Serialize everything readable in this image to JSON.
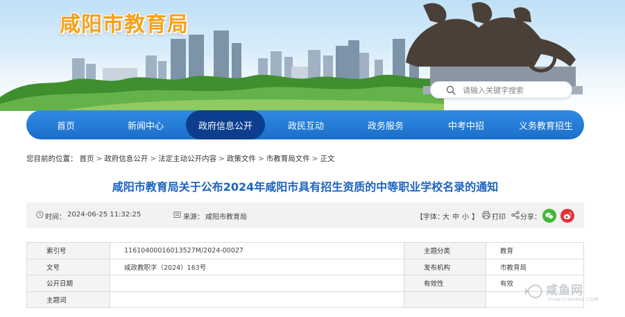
{
  "header": {
    "site_title": "咸阳市教育局",
    "search": {
      "placeholder": "请输入关键字搜索"
    }
  },
  "nav": {
    "items": [
      {
        "label": "首页",
        "active": false
      },
      {
        "label": "新闻中心",
        "active": false
      },
      {
        "label": "政府信息公开",
        "active": true
      },
      {
        "label": "政民互动",
        "active": false
      },
      {
        "label": "政务服务",
        "active": false
      },
      {
        "label": "中考中招",
        "active": false
      },
      {
        "label": "义务教育招生",
        "active": false
      }
    ]
  },
  "breadcrumb": {
    "prefix": "您目前的位置：",
    "items": [
      "首页",
      "政府信息公开",
      "法定主动公开内容",
      "政策文件",
      "市教育局文件",
      "正文"
    ],
    "separator": ">"
  },
  "article": {
    "title": "咸阳市教育局关于公布2024年咸阳市具有招生资质的中等职业学校名录的通知"
  },
  "meta": {
    "time_label": "时间：",
    "time_value": "2024-06-25 11:32:25",
    "source_label": "来源：",
    "source_value": "咸阳市教育局",
    "font_size_label": "【字体：",
    "font_large": "大",
    "font_medium": "中",
    "font_small": "小",
    "font_size_close": "】",
    "print_label": "打印",
    "share_label": "分享："
  },
  "info_table": {
    "rows": [
      {
        "label1": "索引号",
        "value1": "11610400016013527M/2024-00027",
        "label2": "主题分类",
        "value2": "教育"
      },
      {
        "label1": "文号",
        "value1": "咸政教职字（2024）163号",
        "label2": "发布机构",
        "value2": "市教育局"
      },
      {
        "label1": "公开日期",
        "value1": "",
        "label2": "有效性",
        "value2": "有效"
      },
      {
        "label1": "主题词",
        "value1": "",
        "label2": "",
        "value2": ""
      }
    ]
  },
  "watermark": {
    "text": "咸鱼网",
    "sub": "XIANYUWANG.COM"
  },
  "colors": {
    "nav_blue": "#1f74d0",
    "nav_active": "#0c3e8d",
    "title_blue": "#1a63c2",
    "logo_orange": "#f7a11a",
    "wechat_green": "#3fb837",
    "weibo_red": "#e2333a"
  }
}
